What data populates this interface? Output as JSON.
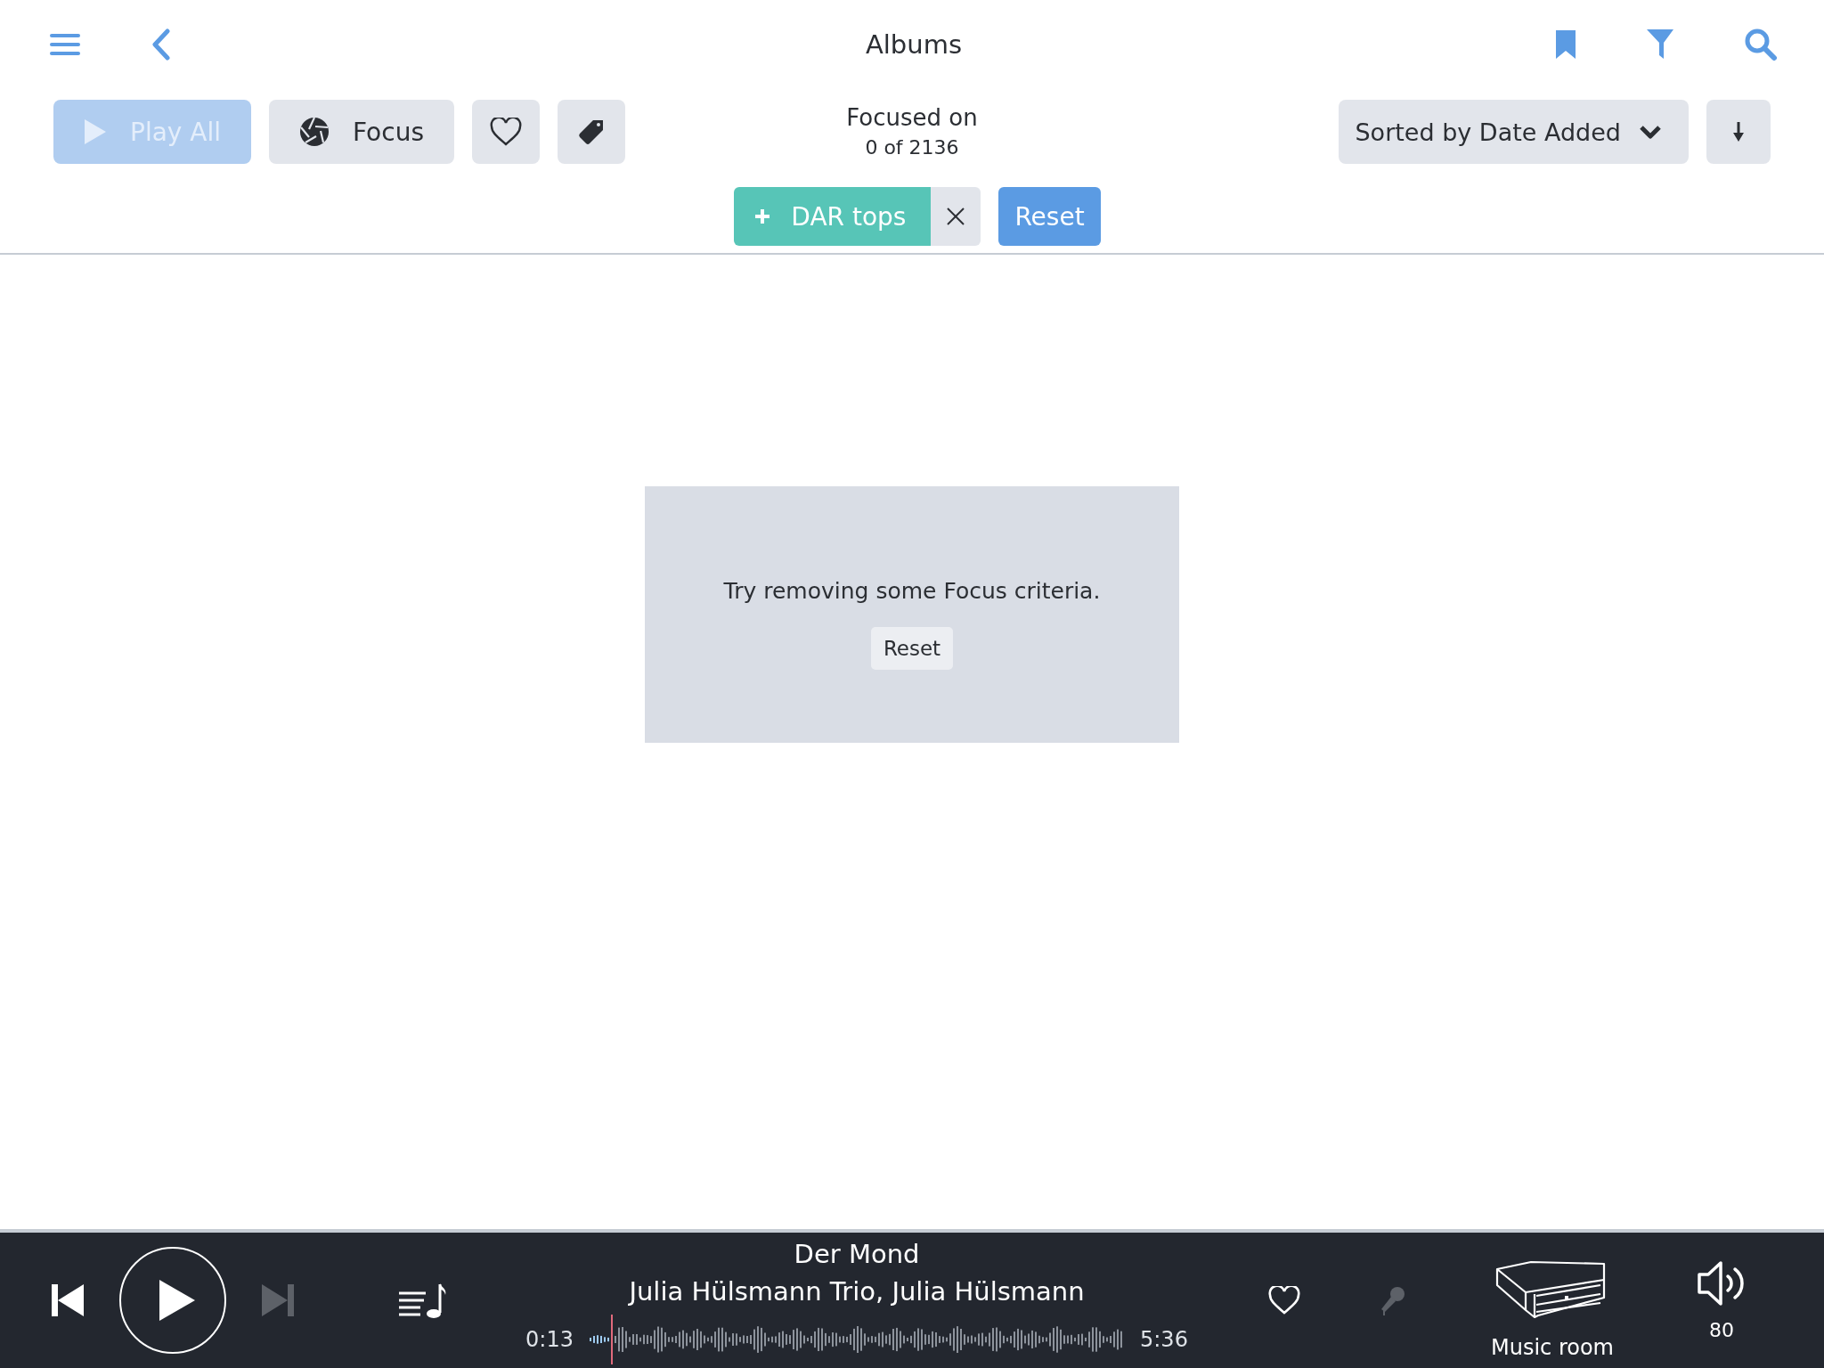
{
  "header": {
    "title": "Albums"
  },
  "toolbar": [
    {
      "kind": "play",
      "label": "Play All",
      "disabled": true
    },
    {
      "kind": "focus",
      "label": "Focus",
      "disabled": false
    },
    {
      "kind": "heart",
      "disabled": false
    },
    {
      "kind": "tag",
      "disabled": false
    }
  ],
  "focus_status": {
    "label": "Focused on",
    "count": "0 of 2136"
  },
  "sort": {
    "label": "Sorted by Date Added"
  },
  "filters": [
    {
      "label": "DAR tops"
    }
  ],
  "reset_button": "Reset",
  "empty_state": {
    "message": "Try removing some Focus criteria.",
    "button": "Reset"
  },
  "player": {
    "transport": [
      {
        "kind": "previous",
        "disabled": false
      },
      {
        "kind": "play",
        "disabled": false
      },
      {
        "kind": "next",
        "disabled": true
      }
    ],
    "title": "Der Mond",
    "artist": "Julia Hülsmann Trio, Julia Hülsmann",
    "elapsed": "0:13",
    "duration": "5:36",
    "level": 0.04,
    "lyrics_disabled": true,
    "device": "Music room",
    "volume": "80"
  }
}
